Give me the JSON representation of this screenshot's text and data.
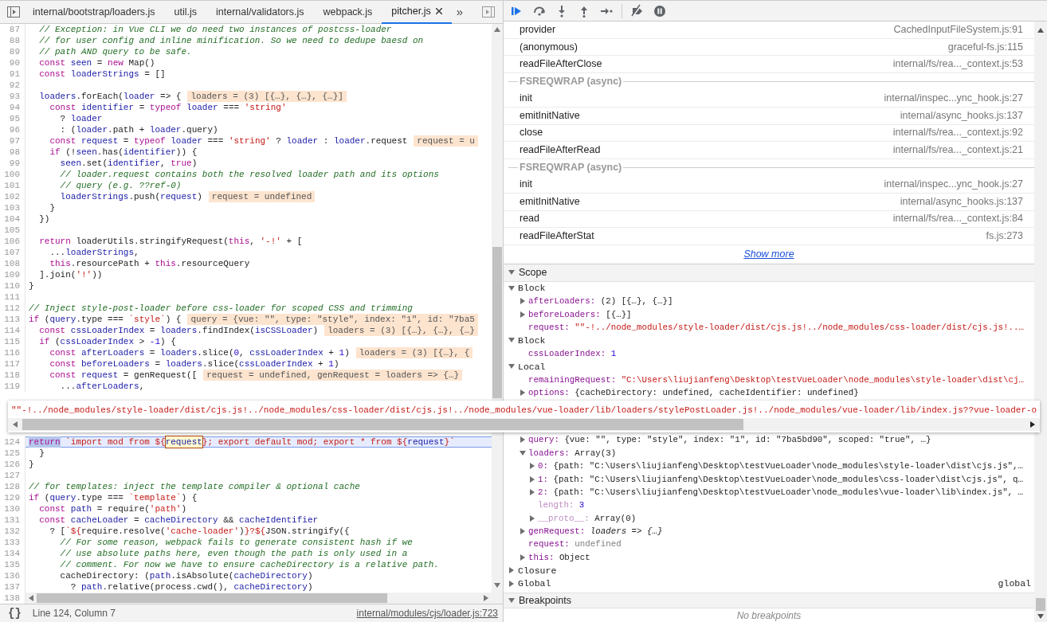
{
  "editor": {
    "tabs": [
      {
        "label": "internal/bootstrap/loaders.js",
        "selected": false
      },
      {
        "label": "util.js",
        "selected": false
      },
      {
        "label": "internal/validators.js",
        "selected": false
      },
      {
        "label": "webpack.js",
        "selected": false
      },
      {
        "label": "pitcher.js",
        "selected": true
      }
    ],
    "overflow": "»",
    "lines": [
      {
        "n": "87",
        "current": false,
        "code": [
          {
            "kind": "c",
            "text": "  // Exception: in Vue CLI we do need two instances of postcss-loader"
          }
        ]
      },
      {
        "n": "88",
        "current": false,
        "code": [
          {
            "kind": "c",
            "text": "  // for user config and inline minification. So we need to dedupe baesd on"
          }
        ]
      },
      {
        "n": "89",
        "current": false,
        "code": [
          {
            "kind": "c",
            "text": "  // path AND query to be safe."
          }
        ]
      },
      {
        "n": "90",
        "current": false,
        "code": [
          {
            "kind": "k",
            "text": "  const"
          },
          {
            "kind": "v",
            "text": " seen"
          },
          {
            "kind": "p",
            "text": " = "
          },
          {
            "kind": "k",
            "text": "new"
          },
          {
            "kind": "p",
            "text": " Map()"
          }
        ]
      },
      {
        "n": "91",
        "current": false,
        "code": [
          {
            "kind": "k",
            "text": "  const"
          },
          {
            "kind": "v",
            "text": " loaderStrings"
          },
          {
            "kind": "p",
            "text": " = []"
          }
        ]
      },
      {
        "n": "92",
        "current": false
      },
      {
        "n": "93",
        "current": false,
        "code": [
          {
            "kind": "v",
            "text": "  loaders"
          },
          {
            "kind": "p",
            "text": ".forEach("
          },
          {
            "kind": "v",
            "text": "loader"
          },
          {
            "kind": "p",
            "text": " => {"
          }
        ],
        "value": "loaders = (3) [{…}, {…}, {…}]"
      },
      {
        "n": "94",
        "current": false,
        "code": [
          {
            "kind": "k",
            "text": "    const"
          },
          {
            "kind": "v",
            "text": " identifier"
          },
          {
            "kind": "p",
            "text": " = "
          },
          {
            "kind": "k",
            "text": "typeof"
          },
          {
            "kind": "v",
            "text": " loader"
          },
          {
            "kind": "p",
            "text": " === "
          },
          {
            "kind": "s",
            "text": "'string'"
          }
        ]
      },
      {
        "n": "95",
        "current": false,
        "code": [
          {
            "kind": "p",
            "text": "      ? "
          },
          {
            "kind": "v",
            "text": "loader"
          }
        ]
      },
      {
        "n": "96",
        "current": false,
        "code": [
          {
            "kind": "p",
            "text": "      : ("
          },
          {
            "kind": "v",
            "text": "loader"
          },
          {
            "kind": "p",
            "text": ".path + "
          },
          {
            "kind": "v",
            "text": "loader"
          },
          {
            "kind": "p",
            "text": ".query)"
          }
        ]
      },
      {
        "n": "97",
        "current": false,
        "code": [
          {
            "kind": "k",
            "text": "    const"
          },
          {
            "kind": "v",
            "text": " request"
          },
          {
            "kind": "p",
            "text": " = "
          },
          {
            "kind": "k",
            "text": "typeof"
          },
          {
            "kind": "v",
            "text": " loader"
          },
          {
            "kind": "p",
            "text": " === "
          },
          {
            "kind": "s",
            "text": "'string'"
          },
          {
            "kind": "p",
            "text": " ? "
          },
          {
            "kind": "v",
            "text": "loader"
          },
          {
            "kind": "p",
            "text": " : "
          },
          {
            "kind": "v",
            "text": "loader"
          },
          {
            "kind": "p",
            "text": ".request"
          }
        ],
        "value": "request = u"
      },
      {
        "n": "98",
        "current": false,
        "code": [
          {
            "kind": "k",
            "text": "    if"
          },
          {
            "kind": "p",
            "text": " (!"
          },
          {
            "kind": "v",
            "text": "seen"
          },
          {
            "kind": "p",
            "text": ".has("
          },
          {
            "kind": "v",
            "text": "identifier"
          },
          {
            "kind": "p",
            "text": ")) {"
          }
        ]
      },
      {
        "n": "99",
        "current": false,
        "code": [
          {
            "kind": "v",
            "text": "      seen"
          },
          {
            "kind": "p",
            "text": ".set("
          },
          {
            "kind": "v",
            "text": "identifier"
          },
          {
            "kind": "p",
            "text": ", "
          },
          {
            "kind": "k",
            "text": "true"
          },
          {
            "kind": "p",
            "text": ")"
          }
        ]
      },
      {
        "n": "100",
        "current": false,
        "code": [
          {
            "kind": "c",
            "text": "      // loader.request contains both the resolved loader path and its options"
          }
        ]
      },
      {
        "n": "101",
        "current": false,
        "code": [
          {
            "kind": "c",
            "text": "      // query (e.g. ??ref-0)"
          }
        ]
      },
      {
        "n": "102",
        "current": false,
        "code": [
          {
            "kind": "v",
            "text": "      loaderStrings"
          },
          {
            "kind": "p",
            "text": ".push("
          },
          {
            "kind": "v",
            "text": "request"
          },
          {
            "kind": "p",
            "text": ")"
          }
        ],
        "value": "request = undefined"
      },
      {
        "n": "103",
        "current": false,
        "code": [
          {
            "kind": "p",
            "text": "    }"
          }
        ]
      },
      {
        "n": "104",
        "current": false,
        "code": [
          {
            "kind": "p",
            "text": "  })"
          }
        ]
      },
      {
        "n": "105",
        "current": false
      },
      {
        "n": "106",
        "current": false,
        "code": [
          {
            "kind": "k",
            "text": "  return"
          },
          {
            "kind": "p",
            "text": " loaderUtils.stringifyRequest("
          },
          {
            "kind": "k",
            "text": "this"
          },
          {
            "kind": "p",
            "text": ", "
          },
          {
            "kind": "s",
            "text": "'-!'"
          },
          {
            "kind": "p",
            "text": " + ["
          }
        ]
      },
      {
        "n": "107",
        "current": false,
        "code": [
          {
            "kind": "p",
            "text": "    ..."
          },
          {
            "kind": "v",
            "text": "loaderStrings"
          },
          {
            "kind": "p",
            "text": ","
          }
        ]
      },
      {
        "n": "108",
        "current": false,
        "code": [
          {
            "kind": "k",
            "text": "    this"
          },
          {
            "kind": "p",
            "text": ".resourcePath + "
          },
          {
            "kind": "k",
            "text": "this"
          },
          {
            "kind": "p",
            "text": ".resourceQuery"
          }
        ]
      },
      {
        "n": "109",
        "current": false,
        "code": [
          {
            "kind": "p",
            "text": "  ].join("
          },
          {
            "kind": "s",
            "text": "'!'"
          },
          {
            "kind": "p",
            "text": "))"
          }
        ]
      },
      {
        "n": "110",
        "current": false,
        "code": [
          {
            "kind": "p",
            "text": "}"
          }
        ]
      },
      {
        "n": "111",
        "current": false
      },
      {
        "n": "112",
        "current": false,
        "code": [
          {
            "kind": "c",
            "text": "// Inject style-post-loader before css-loader for scoped CSS and trimming"
          }
        ]
      },
      {
        "n": "113",
        "current": false,
        "code": [
          {
            "kind": "k",
            "text": "if"
          },
          {
            "kind": "p",
            "text": " ("
          },
          {
            "kind": "v",
            "text": "query"
          },
          {
            "kind": "p",
            "text": ".type === "
          },
          {
            "kind": "s",
            "text": "`style`"
          },
          {
            "kind": "p",
            "text": ") {"
          }
        ],
        "value": "query = {vue: \"\", type: \"style\", index: \"1\", id: \"7ba5"
      },
      {
        "n": "114",
        "current": false,
        "code": [
          {
            "kind": "k",
            "text": "  const"
          },
          {
            "kind": "v",
            "text": " cssLoaderIndex"
          },
          {
            "kind": "p",
            "text": " = "
          },
          {
            "kind": "v",
            "text": "loaders"
          },
          {
            "kind": "p",
            "text": ".findIndex("
          },
          {
            "kind": "v",
            "text": "isCSSLoader"
          },
          {
            "kind": "p",
            "text": ")"
          }
        ],
        "value": "loaders = (3) [{…}, {…}, {…}"
      },
      {
        "n": "115",
        "current": false,
        "code": [
          {
            "kind": "k",
            "text": "  if"
          },
          {
            "kind": "p",
            "text": " ("
          },
          {
            "kind": "v",
            "text": "cssLoaderIndex"
          },
          {
            "kind": "p",
            "text": " > "
          },
          {
            "kind": "n",
            "text": "-1"
          },
          {
            "kind": "p",
            "text": ") {"
          }
        ]
      },
      {
        "n": "116",
        "current": false,
        "code": [
          {
            "kind": "k",
            "text": "    const"
          },
          {
            "kind": "v",
            "text": " afterLoaders"
          },
          {
            "kind": "p",
            "text": " = "
          },
          {
            "kind": "v",
            "text": "loaders"
          },
          {
            "kind": "p",
            "text": ".slice("
          },
          {
            "kind": "n",
            "text": "0"
          },
          {
            "kind": "p",
            "text": ", "
          },
          {
            "kind": "v",
            "text": "cssLoaderIndex"
          },
          {
            "kind": "p",
            "text": " + "
          },
          {
            "kind": "n",
            "text": "1"
          },
          {
            "kind": "p",
            "text": ")"
          }
        ],
        "value": "loaders = (3) [{…}, {"
      },
      {
        "n": "117",
        "current": false,
        "code": [
          {
            "kind": "k",
            "text": "    const"
          },
          {
            "kind": "v",
            "text": " beforeLoaders"
          },
          {
            "kind": "p",
            "text": " = "
          },
          {
            "kind": "v",
            "text": "loaders"
          },
          {
            "kind": "p",
            "text": ".slice("
          },
          {
            "kind": "v",
            "text": "cssLoaderIndex"
          },
          {
            "kind": "p",
            "text": " + "
          },
          {
            "kind": "n",
            "text": "1"
          },
          {
            "kind": "p",
            "text": ")"
          }
        ]
      },
      {
        "n": "118",
        "current": false,
        "code": [
          {
            "kind": "k",
            "text": "    const"
          },
          {
            "kind": "v",
            "text": " request"
          },
          {
            "kind": "p",
            "text": " = genRequest(["
          }
        ],
        "value": "request = undefined, genRequest = loaders => {…}"
      },
      {
        "n": "119",
        "current": false,
        "code": [
          {
            "kind": "p",
            "text": "      ..."
          },
          {
            "kind": "v",
            "text": "afterLoaders"
          },
          {
            "kind": "p",
            "text": ","
          }
        ]
      },
      {
        "n": "124",
        "current": true,
        "code": [
          {
            "kind": "ksel",
            "text": "return"
          },
          {
            "kind": "s",
            "text": " `import mod from ${"
          },
          {
            "kind": "vfocus",
            "text": "request"
          },
          {
            "kind": "s",
            "text": "}; export default mod; export * from ${"
          },
          {
            "kind": "v",
            "text": "request"
          },
          {
            "kind": "s",
            "text": "}`"
          }
        ]
      },
      {
        "n": "125",
        "current": false,
        "code": [
          {
            "kind": "p",
            "text": "  }"
          }
        ]
      },
      {
        "n": "126",
        "current": false,
        "code": [
          {
            "kind": "p",
            "text": "}"
          }
        ]
      },
      {
        "n": "127",
        "current": false
      },
      {
        "n": "128",
        "current": false,
        "code": [
          {
            "kind": "c",
            "text": "// for templates: inject the template compiler & optional cache"
          }
        ]
      },
      {
        "n": "129",
        "current": false,
        "code": [
          {
            "kind": "k",
            "text": "if"
          },
          {
            "kind": "p",
            "text": " ("
          },
          {
            "kind": "v",
            "text": "query"
          },
          {
            "kind": "p",
            "text": ".type === "
          },
          {
            "kind": "s",
            "text": "`template`"
          },
          {
            "kind": "p",
            "text": ") {"
          }
        ]
      },
      {
        "n": "130",
        "current": false,
        "code": [
          {
            "kind": "k",
            "text": "  const"
          },
          {
            "kind": "v",
            "text": " path"
          },
          {
            "kind": "p",
            "text": " = require("
          },
          {
            "kind": "s",
            "text": "'path'"
          },
          {
            "kind": "p",
            "text": ")"
          }
        ]
      },
      {
        "n": "131",
        "current": false,
        "code": [
          {
            "kind": "k",
            "text": "  const"
          },
          {
            "kind": "v",
            "text": " cacheLoader"
          },
          {
            "kind": "p",
            "text": " = "
          },
          {
            "kind": "v",
            "text": "cacheDirectory"
          },
          {
            "kind": "p",
            "text": " && "
          },
          {
            "kind": "v",
            "text": "cacheIdentifier"
          }
        ]
      },
      {
        "n": "132",
        "current": false,
        "code": [
          {
            "kind": "p",
            "text": "    ? ["
          },
          {
            "kind": "s",
            "text": "`${"
          },
          {
            "kind": "p",
            "text": "require.resolve("
          },
          {
            "kind": "s",
            "text": "'cache-loader'"
          },
          {
            "kind": "p",
            "text": ")"
          },
          {
            "kind": "s",
            "text": "}?${"
          },
          {
            "kind": "p",
            "text": "JSON.stringify({"
          }
        ]
      },
      {
        "n": "133",
        "current": false,
        "code": [
          {
            "kind": "c",
            "text": "      // For some reason, webpack fails to generate consistent hash if we"
          }
        ]
      },
      {
        "n": "134",
        "current": false,
        "code": [
          {
            "kind": "c",
            "text": "      // use absolute paths here, even though the path is only used in a"
          }
        ]
      },
      {
        "n": "135",
        "current": false,
        "code": [
          {
            "kind": "c",
            "text": "      // comment. For now we have to ensure cacheDirectory is a relative path."
          }
        ]
      },
      {
        "n": "136",
        "current": false,
        "code": [
          {
            "kind": "p",
            "text": "      cacheDirectory: ("
          },
          {
            "kind": "v",
            "text": "path"
          },
          {
            "kind": "p",
            "text": ".isAbsolute("
          },
          {
            "kind": "v",
            "text": "cacheDirectory"
          },
          {
            "kind": "p",
            "text": ")"
          }
        ]
      },
      {
        "n": "137",
        "current": false,
        "code": [
          {
            "kind": "p",
            "text": "        ? "
          },
          {
            "kind": "v",
            "text": "path"
          },
          {
            "kind": "p",
            "text": ".relative(process.cwd(), "
          },
          {
            "kind": "v",
            "text": "cacheDirectory"
          },
          {
            "kind": "p",
            "text": ")"
          }
        ]
      }
    ],
    "last_line_number": "138",
    "tooltip": "\"\"-!../node_modules/style-loader/dist/cjs.js!../node_modules/css-loader/dist/cjs.js!../node_modules/vue-loader/lib/loaders/stylePostLoader.js!../node_modules/vue-loader/lib/index.js??vue-loader-o",
    "status": {
      "format": "{}",
      "position": "Line 124, Column 7",
      "source": "internal/modules/cjs/loader.js:723"
    }
  },
  "call_stack": [
    {
      "kind": "frame",
      "name": "provider",
      "location": "CachedInputFileSystem.js:91"
    },
    {
      "kind": "frame",
      "name": "(anonymous)",
      "location": "graceful-fs.js:115"
    },
    {
      "kind": "frame",
      "name": "readFileAfterClose",
      "location": "internal/fs/rea..._context.js:53"
    },
    {
      "kind": "async",
      "name": "FSREQWRAP (async)"
    },
    {
      "kind": "frame",
      "name": "init",
      "location": "internal/inspec...ync_hook.js:27"
    },
    {
      "kind": "frame",
      "name": "emitInitNative",
      "location": "internal/async_hooks.js:137"
    },
    {
      "kind": "frame",
      "name": "close",
      "location": "internal/fs/rea..._context.js:92"
    },
    {
      "kind": "frame",
      "name": "readFileAfterRead",
      "location": "internal/fs/rea..._context.js:21"
    },
    {
      "kind": "async",
      "name": "FSREQWRAP (async)"
    },
    {
      "kind": "frame",
      "name": "init",
      "location": "internal/inspec...ync_hook.js:27"
    },
    {
      "kind": "frame",
      "name": "emitInitNative",
      "location": "internal/async_hooks.js:137"
    },
    {
      "kind": "frame",
      "name": "read",
      "location": "internal/fs/rea..._context.js:84"
    },
    {
      "kind": "frame",
      "name": "readFileAfterStat",
      "location": "fs.js:273"
    }
  ],
  "show_more": "Show more",
  "scope": {
    "title": "Scope",
    "expanded": true,
    "groups": [
      {
        "name": "Block",
        "expanded": true,
        "entries": [
          {
            "name": "afterLoaders:",
            "kind": "object",
            "value": "(2) [{…}, {…}]",
            "expanded": false
          },
          {
            "name": "beforeLoaders:",
            "kind": "object",
            "value": "[{…}]",
            "expanded": false
          },
          {
            "name": "request:",
            "kind": "string",
            "value": "\"\"-!../node_modules/style-loader/dist/cjs.js!../node_modules/css-loader/dist/cjs.js!..…"
          }
        ]
      },
      {
        "name": "Block",
        "expanded": true,
        "entries": [
          {
            "name": "cssLoaderIndex:",
            "kind": "number",
            "value": "1"
          }
        ]
      },
      {
        "name": "Local",
        "expanded": true,
        "entries": [
          {
            "name": "remainingRequest:",
            "kind": "string",
            "value": "\"C:\\Users\\liujianfeng\\Desktop\\testVueLoader\\node_modules\\style-loader\\dist\\cj…"
          },
          {
            "name": "options:",
            "kind": "object",
            "value": "{cacheDirectory: undefined, cacheIdentifier: undefined}",
            "expanded": false
          },
          {
            "name": "query:",
            "kind": "object",
            "value": "{vue: \"\", type: \"style\", index: \"1\", id: \"7ba5bd90\", scoped: \"true\", …}",
            "expanded": false
          },
          {
            "name": "loaders:",
            "kind": "object",
            "value": "Array(3)",
            "expanded": true,
            "children": [
              {
                "name": "0:",
                "kind": "object",
                "value": "{path: \"C:\\Users\\liujianfeng\\Desktop\\testVueLoader\\node_modules\\style-loader\\dist\\cjs.js\",…",
                "expanded": false
              },
              {
                "name": "1:",
                "kind": "object",
                "value": "{path: \"C:\\Users\\liujianfeng\\Desktop\\testVueLoader\\node_modules\\css-loader\\dist\\cjs.js\", q…",
                "expanded": false
              },
              {
                "name": "2:",
                "kind": "object",
                "value": "{path: \"C:\\Users\\liujianfeng\\Desktop\\testVueLoader\\node_modules\\vue-loader\\lib\\index.js\", …",
                "expanded": false
              },
              {
                "name": "length:",
                "kind": "number",
                "value": "3",
                "dim": true
              },
              {
                "name": "__proto__:",
                "kind": "object",
                "value": "Array(0)",
                "dim": true,
                "expanded": false
              }
            ]
          },
          {
            "name": "genRequest:",
            "kind": "function",
            "value": "loaders => {…}",
            "expanded": false
          },
          {
            "name": "request:",
            "kind": "undefined",
            "value": "undefined"
          },
          {
            "name": "this:",
            "kind": "object",
            "value": "Object",
            "expanded": false
          }
        ]
      },
      {
        "name": "Closure",
        "expanded": false
      },
      {
        "name": "Global",
        "expanded": false,
        "note": "global"
      }
    ]
  },
  "breakpoints": {
    "title": "Breakpoints",
    "expanded": true,
    "empty_text": "No breakpoints"
  }
}
